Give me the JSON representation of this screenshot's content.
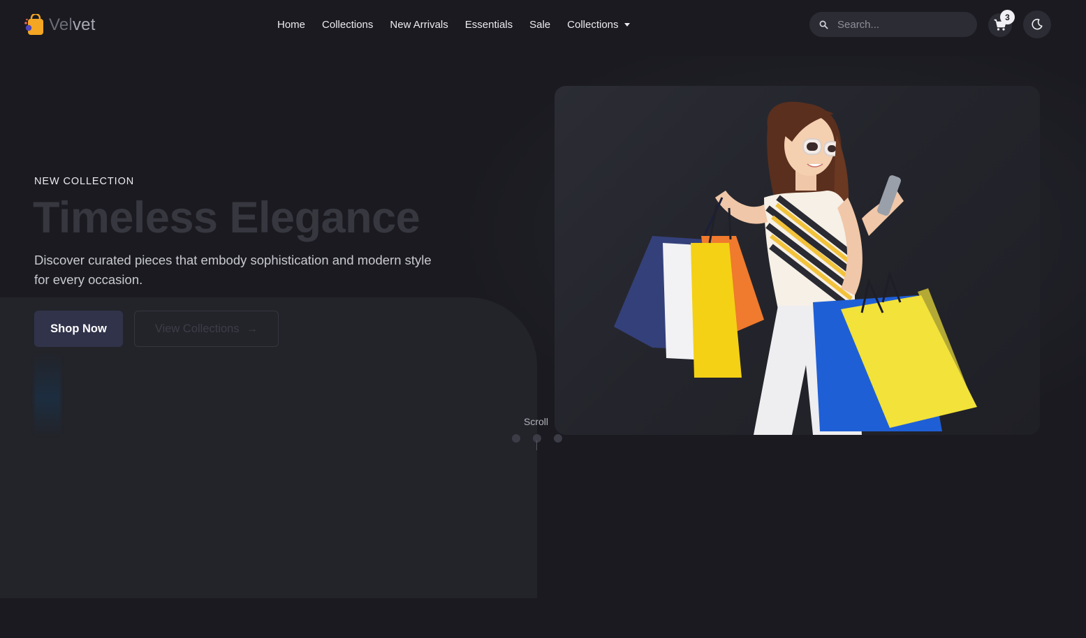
{
  "brand": {
    "name_prefix": "Vel",
    "name_suffix": "vet"
  },
  "nav": {
    "links": [
      "Home",
      "Collections",
      "New Arrivals",
      "Essentials",
      "Sale"
    ],
    "dropdown_label": "Collections"
  },
  "search": {
    "placeholder": "Search..."
  },
  "cart": {
    "count": "3"
  },
  "hero": {
    "eyebrow": "NEW COLLECTION",
    "title": "Timeless Elegance",
    "description": "Discover curated pieces that embody sophistication and modern style for every occasion.",
    "primary_cta": "Shop Now",
    "secondary_cta": "View Collections",
    "secondary_cta_arrow": "→"
  },
  "scroll": {
    "label": "Scroll",
    "slide_count": 3
  },
  "colors": {
    "background": "#1a1a20",
    "panel": "#23242a",
    "accent_orange": "#f5a623",
    "primary_button": "#31334a"
  },
  "icons": {
    "search": "search-icon",
    "cart": "cart-icon",
    "theme": "moon-icon",
    "dropdown": "caret-down-icon",
    "arrow": "arrow-right-icon"
  }
}
